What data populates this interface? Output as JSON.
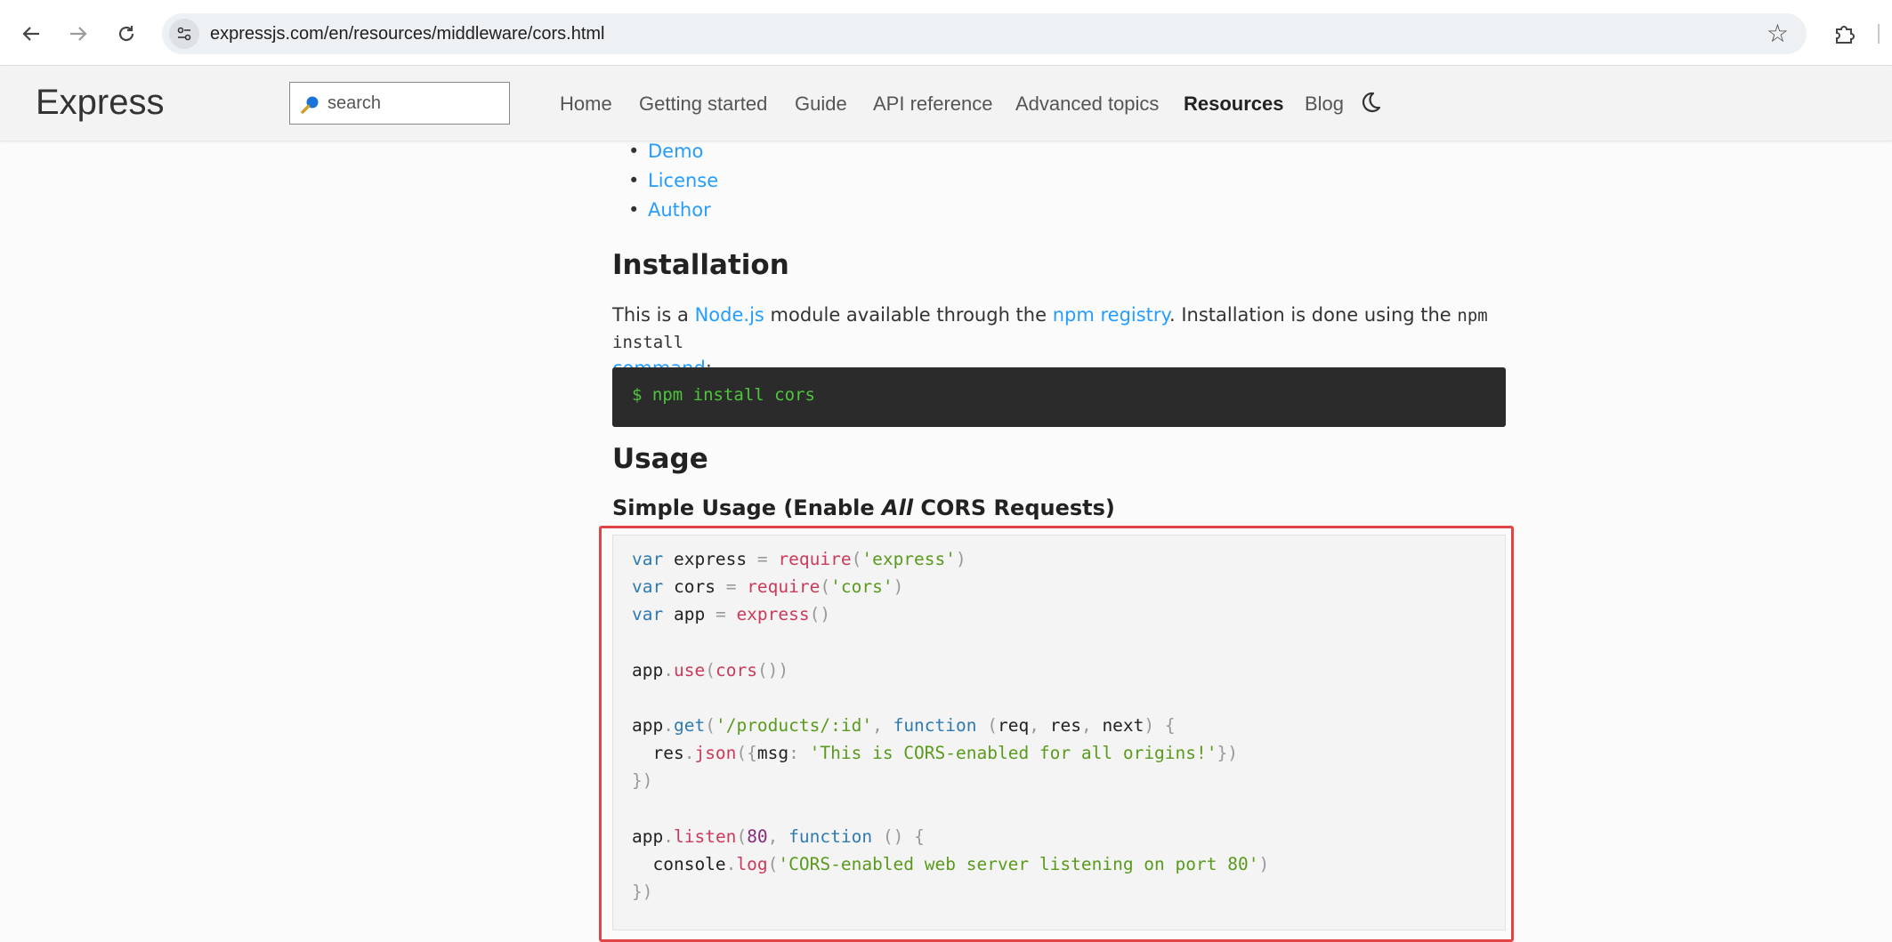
{
  "browser": {
    "url": "expressjs.com/en/resources/middleware/cors.html"
  },
  "header": {
    "logo": "Express",
    "search_placeholder": "search",
    "menu": {
      "home": "Home",
      "getting_started": "Getting started",
      "guide": "Guide",
      "api_reference": "API reference",
      "advanced_topics": "Advanced topics",
      "resources": "Resources",
      "blog": "Blog"
    }
  },
  "toc": {
    "demo": "Demo",
    "license": "License",
    "author": "Author"
  },
  "installation": {
    "heading": "Installation",
    "text_1": "This is a ",
    "link_nodejs": "Node.js",
    "text_2": " module available through the ",
    "link_npm_registry": "npm registry",
    "text_3": ". Installation is done using the ",
    "code_npm_install": "npm install",
    "link_command": "command",
    "text_4": ":",
    "command": "$ npm install cors"
  },
  "usage": {
    "heading": "Usage",
    "subheading_pre": "Simple Usage (Enable ",
    "subheading_em": "All",
    "subheading_post": " CORS Requests)"
  },
  "code": {
    "str_express": "'express'",
    "str_cors": "'cors'",
    "str_route": "'/products/:id'",
    "str_msg": "'This is CORS-enabled for all origins!'",
    "port": "80",
    "str_log": "'CORS-enabled web server listening on port 80'"
  },
  "colors": {
    "link": "#259dff",
    "terminal_bg": "#2b2b2b",
    "terminal_text": "#4ec53d",
    "highlight_border": "#e04444"
  }
}
